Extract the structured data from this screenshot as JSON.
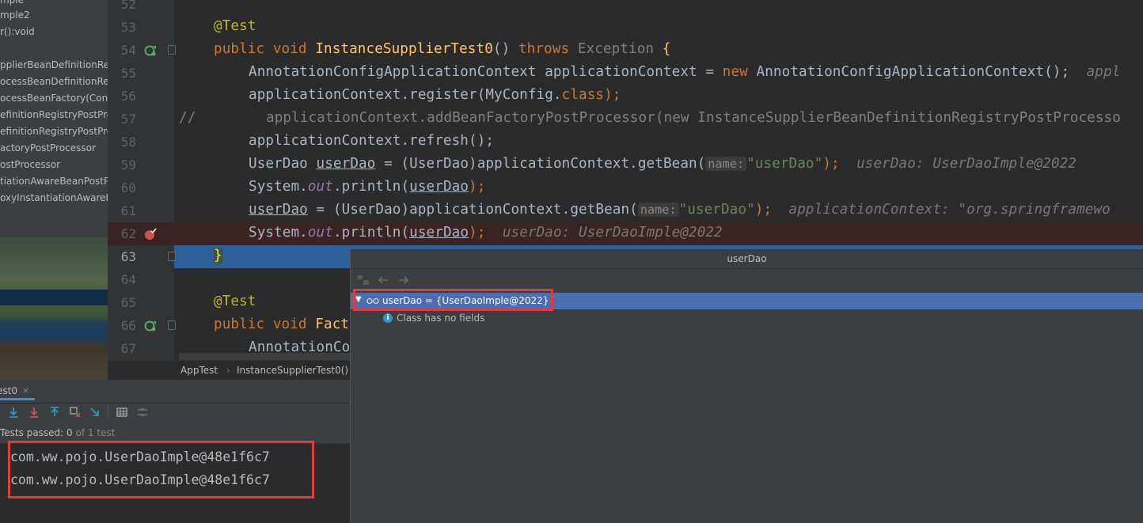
{
  "structure": {
    "items": [
      {
        "label": "mple"
      },
      {
        "label": "mple2"
      },
      {
        "label": "r():void"
      },
      {
        "label": ""
      },
      {
        "label": "pplierBeanDefinitionReg"
      },
      {
        "label": "ocessBeanDefinitionRegi"
      },
      {
        "label": "ocessBeanFactory(Config"
      },
      {
        "label": "efinitionRegistryPostPro"
      },
      {
        "label": "efinitionRegistryPostPro"
      },
      {
        "label": "actoryPostProcessor"
      },
      {
        "label": "ostProcessor"
      },
      {
        "label": "tiationAwareBeanPostPr"
      },
      {
        "label": "oxyInstantiationAwareBe"
      }
    ]
  },
  "editor": {
    "lines": [
      {
        "num": "52"
      },
      {
        "num": "53",
        "annotation": "@Test"
      },
      {
        "num": "54",
        "kw1": "public",
        "kw2": "void",
        "method": "InstanceSupplierTest0",
        "parens": "()",
        "kw3": "throws",
        "exc": "Exception",
        "brace": "{"
      },
      {
        "num": "55",
        "text": "AnnotationConfigApplicationContext applicationContext = ",
        "kw": "new",
        "text2": " AnnotationConfigApplicationContext();",
        "hint": "appl"
      },
      {
        "num": "56",
        "text": "applicationContext.register(MyConfig.",
        "kw": "class",
        "text2": ");"
      },
      {
        "num": "57",
        "comment_mark": "//",
        "text": "applicationContext.addBeanFactoryPostProcessor(new InstanceSupplierBeanDefinitionRegistryPostProcesso"
      },
      {
        "num": "58",
        "text": "applicationContext.refresh();"
      },
      {
        "num": "59",
        "pre": "UserDao ",
        "var": "userDao",
        "mid": " = (UserDao)applicationContext.getBean(",
        "param": "name:",
        "str": "\"userDao\"",
        "end": ");",
        "hint": "userDao: UserDaoImple@2022"
      },
      {
        "num": "60",
        "pre": "System.",
        "field": "out",
        "mid": ".println(",
        "var": "userDao",
        "end": ");"
      },
      {
        "num": "61",
        "var": "userDao",
        "mid": " = (UserDao)applicationContext.getBean(",
        "param": "name:",
        "str": "\"userDao\"",
        "end": ");",
        "hint": "applicationContext: \"org.springframewo"
      },
      {
        "num": "62",
        "pre": "System.",
        "field": "out",
        "mid": ".println(",
        "var": "userDao",
        "end": ");",
        "hint": "userDao: UserDaoImple@2022"
      },
      {
        "num": "63",
        "brace": "}"
      },
      {
        "num": "64"
      },
      {
        "num": "65",
        "annotation": "@Test"
      },
      {
        "num": "66",
        "kw1": "public",
        "kw2": "void",
        "method": "Fact"
      },
      {
        "num": "67",
        "text": "AnnotationCo"
      }
    ]
  },
  "breadcrumb": {
    "class": "AppTest",
    "separator": "›",
    "method": "InstanceSupplierTest0()"
  },
  "run": {
    "tab_label": "est0",
    "tab_close": "×",
    "status_label": "Tests passed: ",
    "status_count": "0",
    "status_total": "of 1 test",
    "console_lines": [
      "com.ww.pojo.UserDaoImple@48e1f6c7",
      "com.ww.pojo.UserDaoImple@48e1f6c7"
    ]
  },
  "popup": {
    "title": "userDao",
    "node_label": "userDao = {UserDaoImple@2022}",
    "child_label": "Class has no fields",
    "info_glyph": "i"
  },
  "colors": {
    "accent": "#4b6eaf",
    "highlight_box": "#e03c3c",
    "current_line": "#2d6099",
    "breakpoint_line": "#3a2323"
  }
}
